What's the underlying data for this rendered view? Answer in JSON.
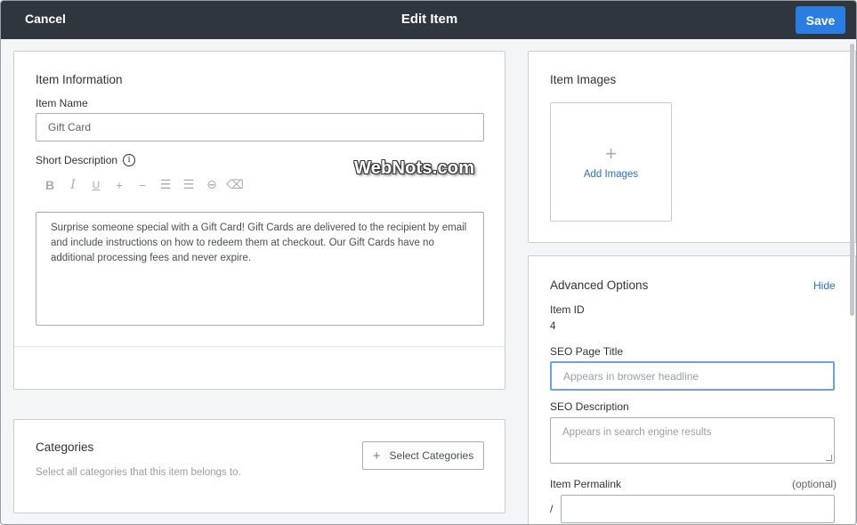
{
  "header": {
    "cancel_label": "Cancel",
    "title": "Edit Item",
    "save_label": "Save"
  },
  "item_information": {
    "heading": "Item Information",
    "name_label": "Item Name",
    "name_value": "Gift Card",
    "short_description_label": "Short Description",
    "info_icon_glyph": "i",
    "description_text": "Surprise someone special with a Gift Card! Gift Cards are delivered to the recipient by email and include instructions on how to redeem them at checkout. Our Gift Cards have no additional processing fees and never expire.",
    "toolbar": {
      "bold": "B",
      "italic": "I",
      "underline": "U",
      "plus": "+",
      "minus": "−",
      "numbered_list": "☰",
      "bullet_list": "☰",
      "link": "⊖",
      "eraser": "⌫"
    }
  },
  "watermark": "WebNots.com",
  "categories": {
    "heading": "Categories",
    "hint": "Select all categories that this item belongs to.",
    "select_plus": "+",
    "select_label": "Select Categories"
  },
  "images": {
    "heading": "Item Images",
    "add_plus": "+",
    "add_label": "Add Images"
  },
  "advanced": {
    "heading": "Advanced Options",
    "hide_label": "Hide",
    "item_id_label": "Item ID",
    "item_id_value": "4",
    "seo_title_label": "SEO Page Title",
    "seo_title_placeholder": "Appears in browser headline",
    "seo_description_label": "SEO Description",
    "seo_description_placeholder": "Appears in search engine results",
    "permalink_label": "Item Permalink",
    "permalink_optional": "(optional)",
    "permalink_prefix": "/"
  },
  "colors": {
    "header_bg": "#2f363d",
    "accent": "#2a7de1",
    "focus_border": "#6f9fe6"
  }
}
